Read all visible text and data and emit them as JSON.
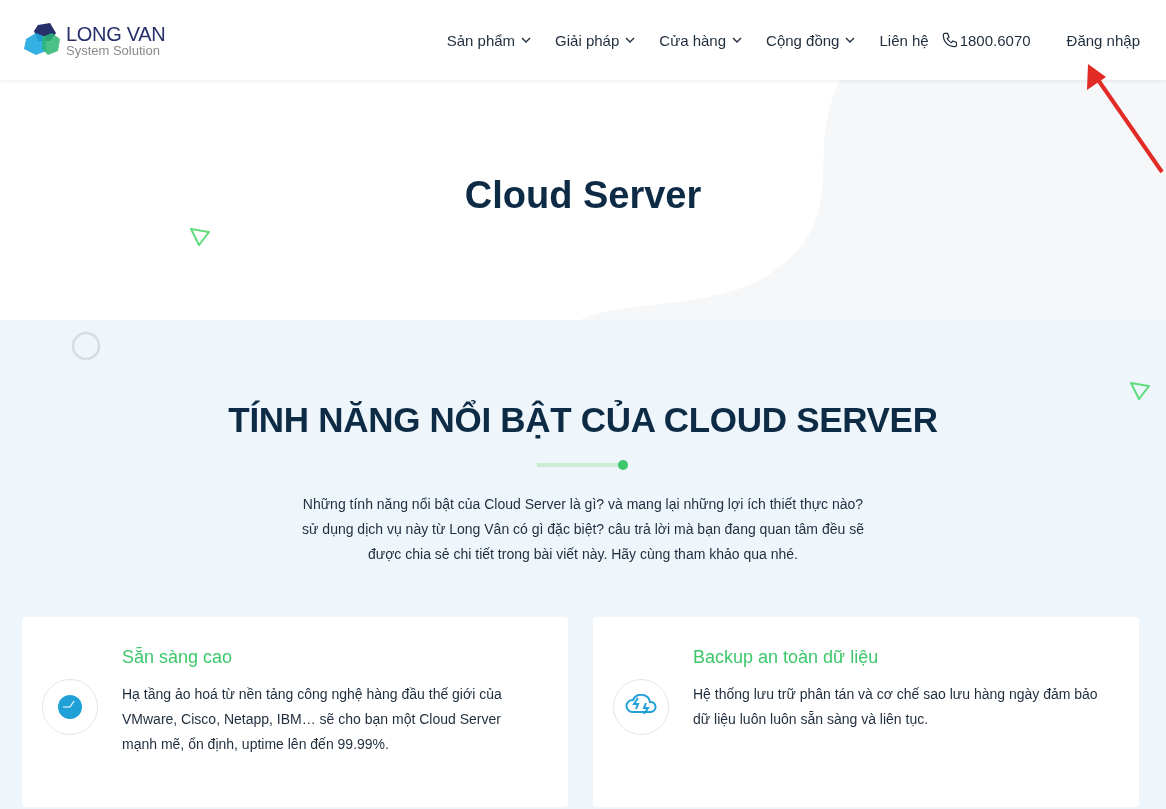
{
  "header": {
    "logo": {
      "name": "LONG VAN",
      "tagline": "System Solution"
    },
    "nav": [
      {
        "label": "Sản phẩm",
        "has_dropdown": true
      },
      {
        "label": "Giải pháp",
        "has_dropdown": true
      },
      {
        "label": "Cửa hàng",
        "has_dropdown": true
      },
      {
        "label": "Cộng đồng",
        "has_dropdown": true
      },
      {
        "label": "Liên hệ",
        "has_dropdown": false
      }
    ],
    "phone": "1800.6070",
    "login": "Đăng nhập"
  },
  "hero": {
    "title": "Cloud Server"
  },
  "features": {
    "title": "TÍNH NĂNG NỔI BẬT CỦA CLOUD SERVER",
    "intro": "Những tính năng nổi bật của Cloud Server là gì? và mang lại những lợi ích thiết thực nào? sử dụng dịch vụ này từ Long Vân có gì đặc biệt? câu trả lời mà bạn đang quan tâm đều sẽ được chia sẻ chi tiết trong bài viết này. Hãy cùng tham khảo qua nhé.",
    "cards": [
      {
        "kind": "clock",
        "title": "Sẵn sàng cao",
        "text": "Hạ tầng ảo hoá từ nền tảng công nghệ hàng đầu thế giới của VMware, Cisco, Netapp, IBM… sẽ cho bạn một Cloud Server mạnh mẽ, ổn định, uptime lên đến 99.99%."
      },
      {
        "kind": "cloud-sync",
        "title": "Backup an toàn dữ liệu",
        "text": "Hệ thống lưu trữ phân tán và cơ chế sao lưu hàng ngày đảm bảo dữ liệu luôn luôn sẵn sàng và liên tục."
      }
    ]
  }
}
